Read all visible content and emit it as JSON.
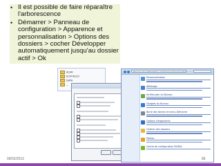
{
  "slide": {
    "bullets": [
      "Il est possible de faire réparaître l'arborescence",
      "Démarrer > Panneau de configuration > Apparence et personnalisation > Options des dossiers > cocher Développer automatiquement jusqu'au dossier actif > Ok"
    ],
    "footer": {
      "date": "09/02/2012",
      "page": "86"
    },
    "colors": {
      "bullet_box": "#f0f4d8",
      "footer_bar": "#8e44ad",
      "accent_blue": "#3d77c4"
    }
  },
  "screenshot": {
    "tree_items": [
      "ACER",
      "ECM RECO",
      "DATA",
      "..."
    ],
    "control_panel": {
      "address": "Panneau de configuration ▸ Apparence et personnalisation",
      "items": [
        "Personnalisation",
        "Affichage",
        "Arrière-plan du Bureau",
        "Gadgets du Bureau",
        "Barre des tâches et menu Démarrer",
        "Options d'ergonomie",
        "Options des dossiers",
        "Polices",
        "Centre de configuration NVIDIA"
      ]
    }
  }
}
